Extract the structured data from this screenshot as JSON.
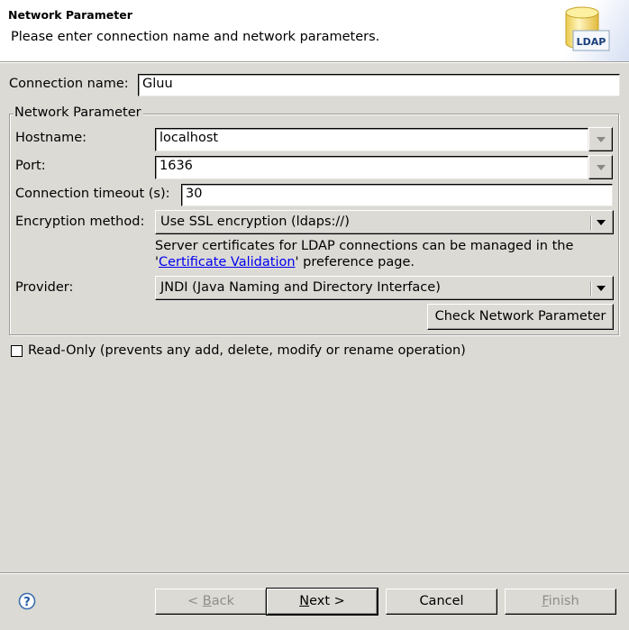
{
  "header": {
    "title": "Network Parameter",
    "description": "Please enter connection name and network parameters.",
    "icon": "ldap-database-icon",
    "icon_label": "LDAP"
  },
  "connection_name": {
    "label": "Connection name:",
    "value": "Gluu"
  },
  "network_group": {
    "title": "Network Parameter",
    "hostname": {
      "label": "Hostname:",
      "value": "localhost"
    },
    "port": {
      "label": "Port:",
      "value": "1636"
    },
    "timeout": {
      "label": "Connection timeout (s):",
      "value": "30"
    },
    "encryption": {
      "label": "Encryption method:",
      "selected": "Use SSL encryption (ldaps://)"
    },
    "cert_info": {
      "line1": "Server certificates for LDAP connections can be managed in the",
      "prefix": "'",
      "link": "Certificate Validation",
      "suffix": "' preference page."
    },
    "provider": {
      "label": "Provider:",
      "selected": "JNDI (Java Naming and Directory Interface)"
    },
    "check_button": "Check Network Parameter"
  },
  "read_only": {
    "label": "Read-Only (prevents any add, delete, modify or rename operation)",
    "checked": false
  },
  "footer": {
    "help_icon": "help-icon",
    "back": {
      "prefix": "< ",
      "mnemonic": "B",
      "rest": "ack",
      "enabled": false
    },
    "next": {
      "mnemonic": "N",
      "rest": "ext >",
      "enabled": true
    },
    "cancel": {
      "label": "Cancel",
      "enabled": true
    },
    "finish": {
      "mnemonic": "F",
      "rest": "inish",
      "enabled": false
    }
  },
  "colors": {
    "background": "#dcdad5",
    "link": "#0000ee",
    "disabled_text": "#8f8d89"
  }
}
